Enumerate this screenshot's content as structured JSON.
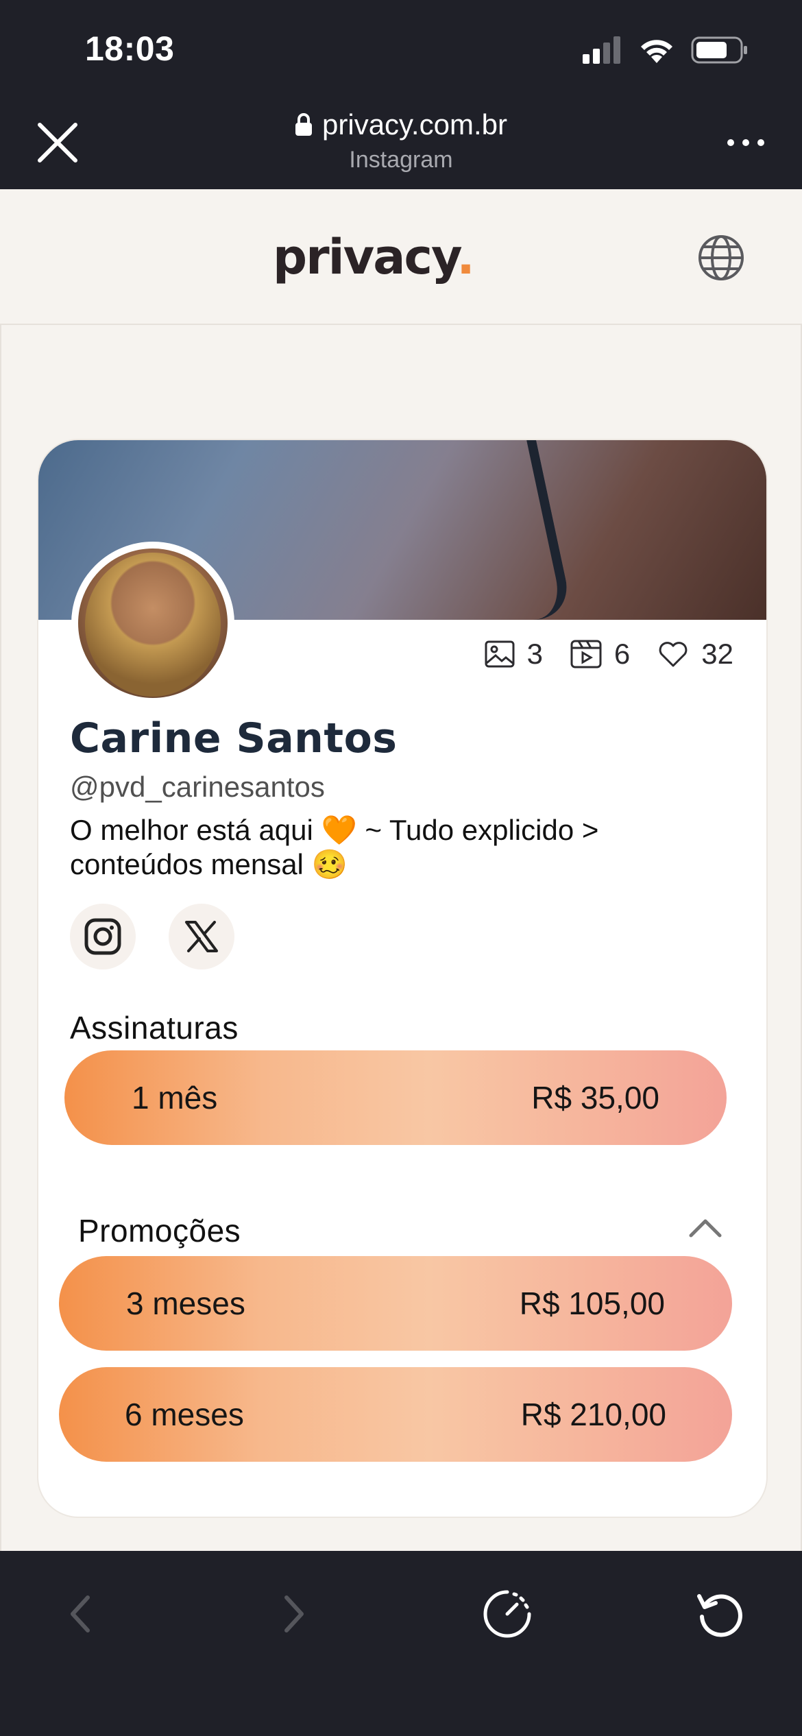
{
  "status_bar": {
    "time": "18:03"
  },
  "browser": {
    "url": "privacy.com.br",
    "subtitle": "Instagram"
  },
  "site": {
    "logo": "privacy",
    "logo_dot": "."
  },
  "profile": {
    "stats": {
      "images": "3",
      "videos": "6",
      "likes": "32"
    },
    "name": "Carine Santos",
    "handle": "@pvd_carinesantos",
    "bio_line1": "O melhor está aqui 🧡 ~ Tudo explicido >",
    "bio_line2": "conteúdos mensal 🥴"
  },
  "subscriptions": {
    "title": "Assinaturas",
    "plans": [
      {
        "label": "1 mês",
        "price": "R$ 35,00"
      }
    ]
  },
  "promotions": {
    "title": "Promoções",
    "plans": [
      {
        "label": "3 meses",
        "price": "R$ 105,00"
      },
      {
        "label": "6 meses",
        "price": "R$ 210,00"
      }
    ]
  },
  "colors": {
    "accent": "#f08a3c",
    "dark_bar": "#1f2028",
    "page_bg": "#f6f3ef"
  }
}
